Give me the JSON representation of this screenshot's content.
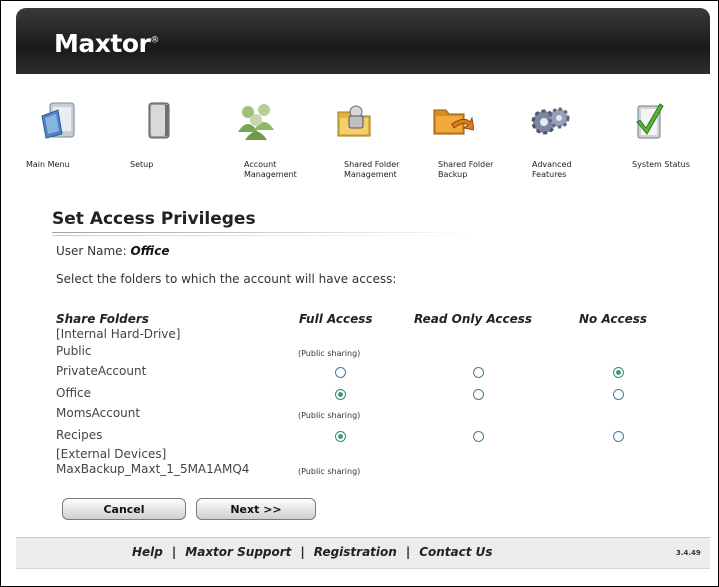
{
  "brand": {
    "logo_text": "Maxtor",
    "logo_mark": "®"
  },
  "nav": [
    {
      "label": "Main Menu",
      "icon": "main-menu-icon"
    },
    {
      "label": "Setup",
      "icon": "setup-icon"
    },
    {
      "label": "Account\nManagement",
      "icon": "account-management-icon"
    },
    {
      "label": "Shared Folder\nManagement",
      "icon": "shared-folder-management-icon"
    },
    {
      "label": "Shared Folder\nBackup",
      "icon": "shared-folder-backup-icon"
    },
    {
      "label": "Advanced\nFeatures",
      "icon": "advanced-features-icon"
    },
    {
      "label": "System Status",
      "icon": "system-status-icon"
    }
  ],
  "page": {
    "title": "Set Access Privileges",
    "user_name_label": "User Name:",
    "user_name_value": "Office",
    "instruction": "Select the folders to which the account will have access:"
  },
  "table": {
    "headers": {
      "folders": "Share Folders",
      "full": "Full Access",
      "read": "Read Only Access",
      "none": "No Access"
    },
    "groups": {
      "internal": "[Internal Hard-Drive]",
      "external": "[External Devices]"
    },
    "public_text": "(Public sharing)",
    "rows": [
      {
        "name": "Public",
        "access": "public"
      },
      {
        "name": "PrivateAccount",
        "access": "none"
      },
      {
        "name": "Office",
        "access": "full"
      },
      {
        "name": "MomsAccount",
        "access": "public"
      },
      {
        "name": "Recipes",
        "access": "full"
      },
      {
        "name": "MaxBackup_Maxt_1_5MA1AMQ4",
        "access": "public"
      }
    ]
  },
  "buttons": {
    "cancel": "Cancel",
    "next": "Next >>"
  },
  "footer": {
    "links": [
      "Help",
      "Maxtor Support",
      "Registration",
      "Contact Us"
    ],
    "separator": "|",
    "version": "3.4.49"
  },
  "colors": {
    "header_bg": "#1a1a1a",
    "radio_border": "#4c7a98",
    "radio_selected": "#3aa84a",
    "footer_bg": "#ececec"
  }
}
